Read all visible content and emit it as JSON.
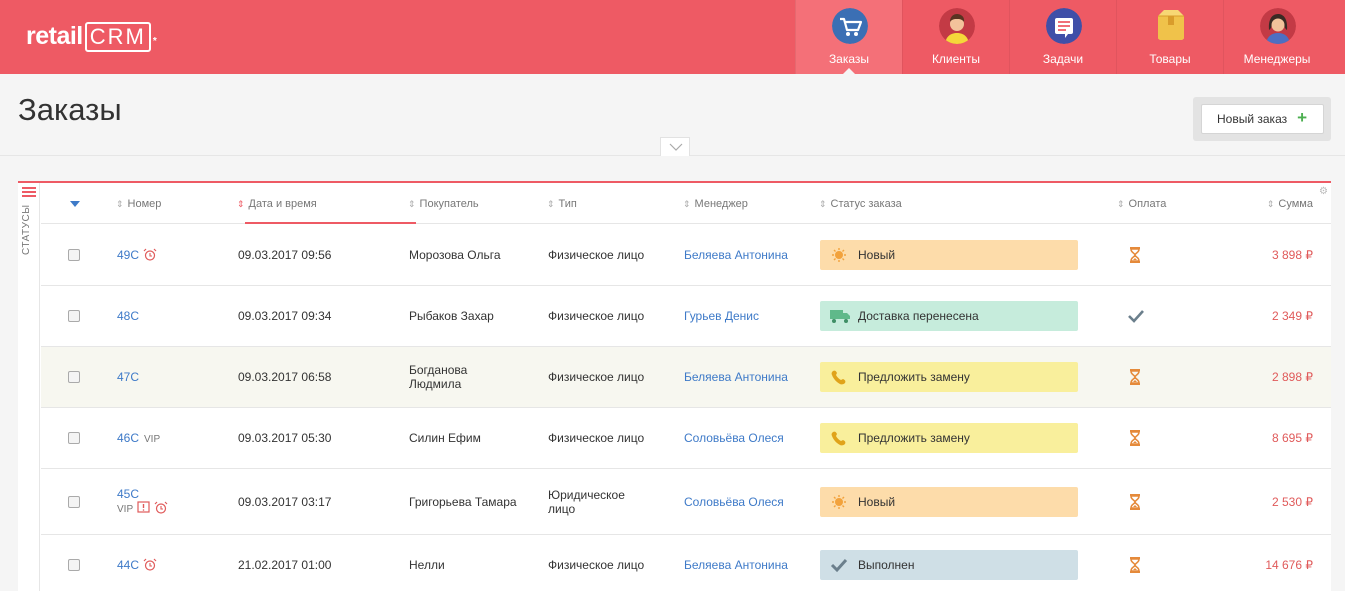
{
  "app": {
    "logo_main": "retail",
    "logo_crm": "CRM",
    "logo_star": "*"
  },
  "nav": {
    "items": [
      {
        "label": "Заказы",
        "icon": "cart-icon",
        "active": true
      },
      {
        "label": "Клиенты",
        "icon": "client-avatar-icon",
        "active": false
      },
      {
        "label": "Задачи",
        "icon": "tasks-list-icon",
        "active": false
      },
      {
        "label": "Товары",
        "icon": "products-box-icon",
        "active": false
      },
      {
        "label": "Менеджеры",
        "icon": "manager-avatar-icon",
        "active": false
      }
    ]
  },
  "page": {
    "title": "Заказы",
    "new_order_label": "Новый заказ",
    "new_order_plus": "+"
  },
  "sidebar": {
    "statuses_label": "Статусы"
  },
  "table": {
    "columns": {
      "number": "Номер",
      "date": "Дата и время",
      "buyer": "Покупатель",
      "type": "Тип",
      "manager": "Менеджер",
      "status": "Статус заказа",
      "payment": "Оплата",
      "sum": "Сумма"
    },
    "rows": [
      {
        "number": "49С",
        "tag": "",
        "alarm": true,
        "note": false,
        "date": "09.03.2017 09:56",
        "buyer": "Морозова Ольга",
        "type": "Физическое лицо",
        "manager": "Беляева Антонина",
        "status": "Новый",
        "status_kind": "new",
        "payment": "hourglass-icon",
        "sum": "3 898 ₽"
      },
      {
        "number": "48С",
        "tag": "",
        "alarm": false,
        "note": false,
        "date": "09.03.2017 09:34",
        "buyer": "Рыбаков Захар",
        "type": "Физическое лицо",
        "manager": "Гурьев Денис",
        "status": "Доставка перенесена",
        "status_kind": "delivery",
        "payment": "checkmark-icon",
        "sum": "2 349 ₽"
      },
      {
        "number": "47С",
        "tag": "",
        "alarm": false,
        "note": false,
        "date": "09.03.2017 06:58",
        "buyer": "Богданова Людмила",
        "type": "Физическое лицо",
        "manager": "Беляева Антонина",
        "status": "Предложить замену",
        "status_kind": "call",
        "payment": "hourglass-icon",
        "sum": "2 898 ₽"
      },
      {
        "number": "46С",
        "tag": "VIP",
        "alarm": false,
        "note": false,
        "date": "09.03.2017 05:30",
        "buyer": "Силин Ефим",
        "type": "Физическое лицо",
        "manager": "Соловьёва Олеся",
        "status": "Предложить замену",
        "status_kind": "call",
        "payment": "hourglass-icon",
        "sum": "8 695 ₽"
      },
      {
        "number": "45С",
        "tag": "VIP",
        "alarm": true,
        "note": true,
        "date": "09.03.2017 03:17",
        "buyer": "Григорьева Тамара",
        "type": "Юридическое лицо",
        "manager": "Соловьёва Олеся",
        "status": "Новый",
        "status_kind": "new",
        "payment": "hourglass-icon",
        "sum": "2 530 ₽"
      },
      {
        "number": "44С",
        "tag": "",
        "alarm": true,
        "note": false,
        "date": "21.02.2017 01:00",
        "buyer": "Нелли",
        "type": "Физическое лицо",
        "manager": "Беляева Антонина",
        "status": "Выполнен",
        "status_kind": "done",
        "payment": "hourglass-icon",
        "sum": "14 676 ₽"
      }
    ]
  },
  "colors": {
    "brand": "#ee5a64",
    "link": "#3e7ac8",
    "sum": "#e05a5a",
    "status_new": "#fddcaa",
    "status_delivery": "#c6ecdc",
    "status_call": "#f9ef9c",
    "status_done": "#cfdfe6"
  }
}
